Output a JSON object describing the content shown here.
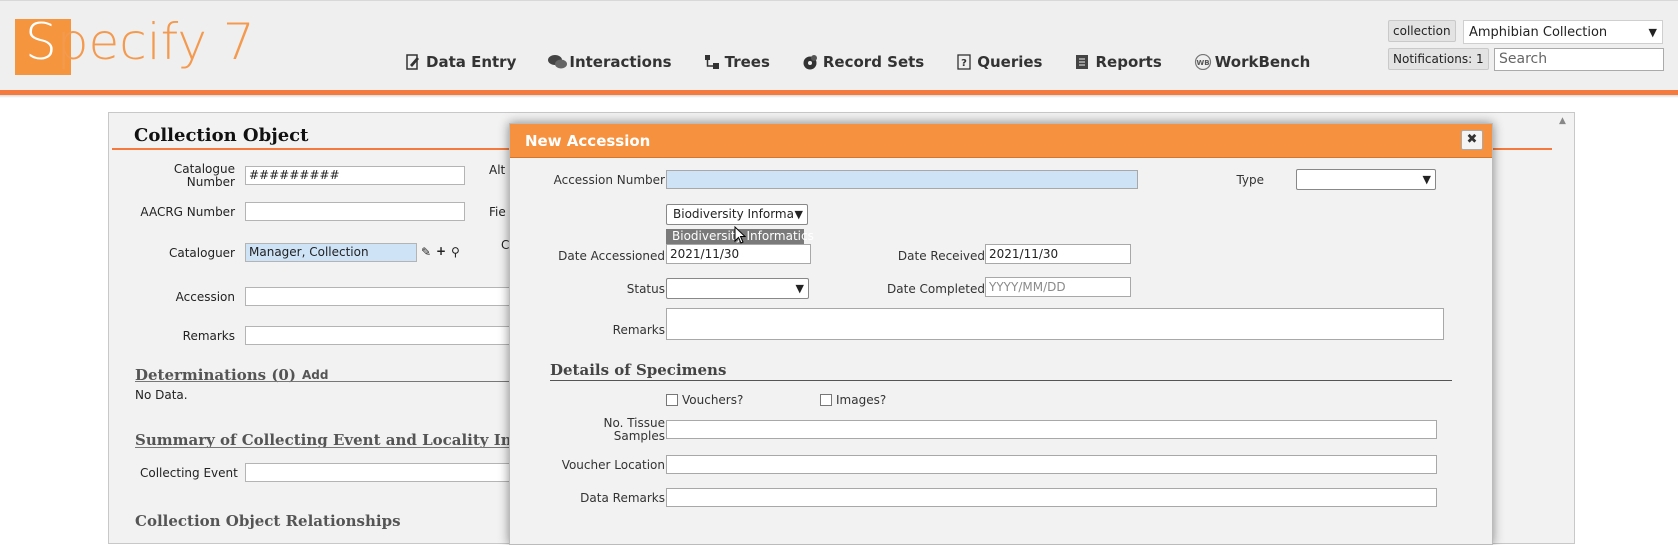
{
  "app": {
    "logo_text_first": "S",
    "logo_text_rest": "pecify 7",
    "accent_color": "#f47b3d"
  },
  "nav": [
    {
      "label": "Data Entry",
      "icon": "data-entry-icon"
    },
    {
      "label": "Interactions",
      "icon": "interactions-icon"
    },
    {
      "label": "Trees",
      "icon": "trees-icon"
    },
    {
      "label": "Record Sets",
      "icon": "record-sets-icon"
    },
    {
      "label": "Queries",
      "icon": "queries-icon"
    },
    {
      "label": "Reports",
      "icon": "reports-icon"
    },
    {
      "label": "WorkBench",
      "icon": "workbench-icon"
    }
  ],
  "header": {
    "collection_label": "collection",
    "collection_value": "Amphibian Collection",
    "notifications": "Notifications: 1",
    "search_placeholder": "Search"
  },
  "form": {
    "title": "Collection Object",
    "catalogue_number_label": "Catalogue\nNumber",
    "catalogue_number_value": "#########",
    "aacrg_label": "AACRG Number",
    "cataloguer_label": "Cataloguer",
    "cataloguer_value": "Manager, Collection",
    "accession_label": "Accession",
    "remarks_label": "Remarks",
    "alt_label_fragment": "Alt",
    "fie_label_fragment": "Fie",
    "c_label_fragment": "C",
    "determinations_title": "Determinations (0)",
    "determinations_add": "Add",
    "no_data": "No Data.",
    "summary_title": "Summary of Collecting Event and Locality Infor",
    "collecting_event_label": "Collecting Event",
    "relationships_title": "Collection Object Relationships"
  },
  "dialog": {
    "title": "New Accession",
    "close_glyph": "✖",
    "accession_number_label": "Accession Number",
    "accession_number_value": "",
    "type_label": "Type",
    "type_value": "",
    "division_value": "Biodiversity Informat",
    "division_option": "Biodiversity Informatics",
    "date_accessioned_label": "Date Accessioned",
    "date_accessioned_value": "2021/11/30",
    "date_received_label": "Date Received",
    "date_received_value": "2021/11/30",
    "status_label": "Status",
    "status_value": "",
    "date_completed_label": "Date Completed",
    "date_completed_placeholder": "YYYY/MM/DD",
    "remarks_label": "Remarks",
    "details_title": "Details of Specimens",
    "vouchers_label": "Vouchers?",
    "images_label": "Images?",
    "tissue_label": "No. Tissue\nSamples",
    "voucher_location_label": "Voucher Location",
    "data_remarks_label": "Data Remarks"
  }
}
